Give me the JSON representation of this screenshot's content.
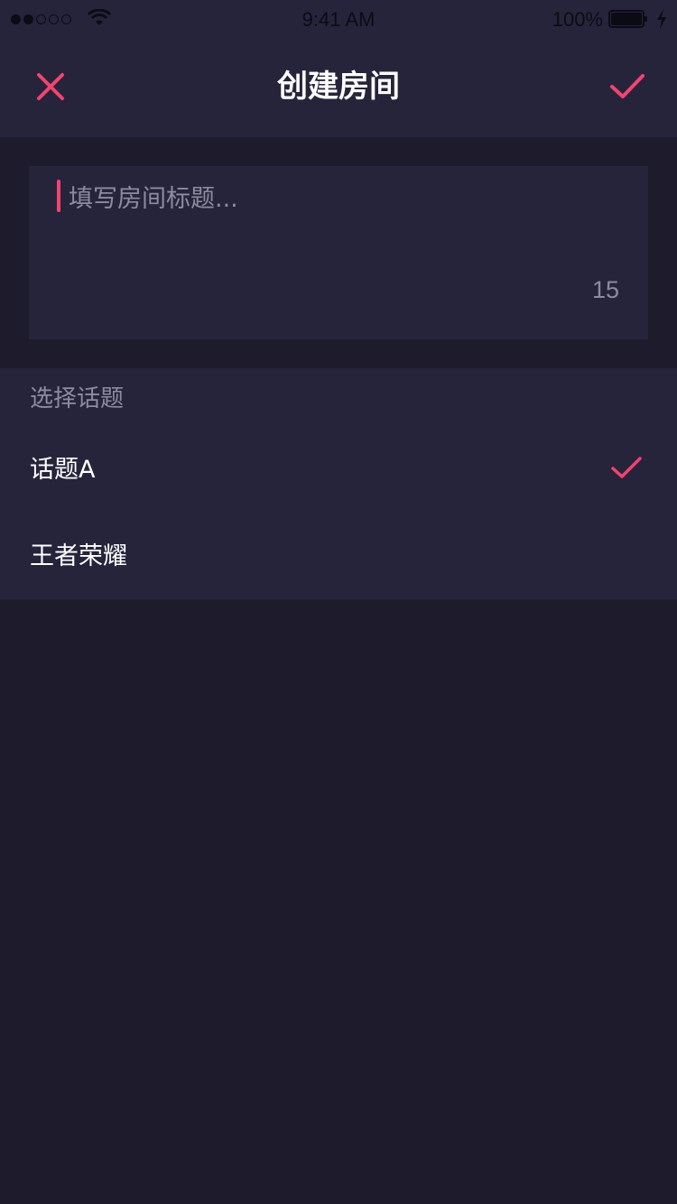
{
  "status_bar": {
    "time": "9:41 AM",
    "battery": "100%",
    "icons": [
      "signal-dots-icon",
      "wifi-icon",
      "battery-icon",
      "charging-bolt-icon"
    ]
  },
  "nav": {
    "title": "创建房间",
    "close_icon": "close-icon",
    "confirm_icon": "checkmark-icon"
  },
  "title_input": {
    "value": "",
    "placeholder": "填写房间标题...",
    "remaining_count": "15"
  },
  "topics": {
    "label": "选择话题",
    "items": [
      {
        "label": "话题A",
        "selected": true
      },
      {
        "label": "王者荣耀",
        "selected": false
      }
    ]
  },
  "colors": {
    "accent": "#f4436e",
    "background": "#1e1c2c",
    "panel": "#25243b",
    "secondary_text": "#8d8b9e"
  }
}
